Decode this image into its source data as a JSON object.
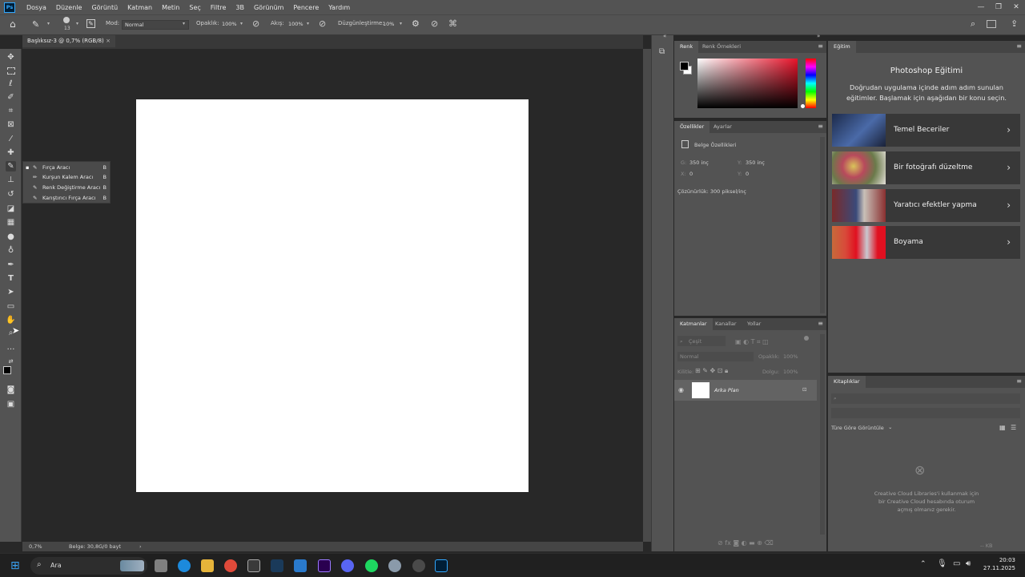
{
  "menu": [
    "Dosya",
    "Düzenle",
    "Görüntü",
    "Katman",
    "Metin",
    "Seç",
    "Filtre",
    "3B",
    "Görünüm",
    "Pencere",
    "Yardım"
  ],
  "app_logo": "Ps",
  "options": {
    "brush_size": "13",
    "mode_label": "Mod:",
    "mode_value": "Normal",
    "opacity_label": "Opaklık:",
    "opacity_value": "100%",
    "flow_label": "Akış:",
    "flow_value": "100%",
    "smoothing_label": "Düzgünleştirme:",
    "smoothing_value": "10%"
  },
  "document": {
    "tab_title": "Başlıksız-3 @ 0,7% (RGB/8)",
    "zoom": "0,7%",
    "doc_info": "Belge: 30,8G/0 bayt"
  },
  "flyout": [
    {
      "label": "Fırça Aracı",
      "key": "B"
    },
    {
      "label": "Kurşun Kalem Aracı",
      "key": "B"
    },
    {
      "label": "Renk Değiştirme Aracı",
      "key": "B"
    },
    {
      "label": "Karıştırıcı Fırça Aracı",
      "key": "B"
    }
  ],
  "color_panel": {
    "tab_active": "Renk",
    "tab_other": "Renk Örnekleri",
    "hue_color": "#e8132a"
  },
  "properties_panel": {
    "tab_active": "Özellikler",
    "tab_other": "Ayarlar",
    "section": "Belge Özellikleri",
    "w_label": "G:",
    "w_value": "350 inç",
    "h_label": "Y:",
    "h_value": "350 inç",
    "x_label": "X:",
    "x_value": "0",
    "y_label": "Y:",
    "y_value": "0",
    "resolution": "Çözünürlük: 300 piksel/inç"
  },
  "layers_panel": {
    "tabs": [
      "Katmanlar",
      "Kanallar",
      "Yollar"
    ],
    "search": "Çeşit",
    "blend": "Normal",
    "opacity_label": "Opaklık:",
    "opacity_value": "100%",
    "lock_label": "Kilitle:",
    "fill_label": "Dolgu:",
    "fill_value": "100%",
    "layer_name": "Arka Plan"
  },
  "learn_panel": {
    "tab": "Eğitim",
    "title": "Photoshop Eğitimi",
    "subtitle_1": "Doğrudan uygulama içinde adım adım sunulan",
    "subtitle_2": "eğitimler. Başlamak için aşağıdan bir konu seçin.",
    "cards": [
      "Temel Beceriler",
      "Bir fotoğrafı düzeltme",
      "Yaratıcı efektler yapma",
      "Boyama"
    ]
  },
  "libraries_panel": {
    "tab": "Kitaplıklar",
    "view_label": "Türe Göre Görüntüle",
    "msg_1": "Creative Cloud Libraries'i kullanmak için",
    "msg_2": "bir Creative Cloud hesabında oturum",
    "msg_3": "açmış olmanız gerekir.",
    "kb": "-- KB"
  },
  "taskbar": {
    "search": "Ara",
    "time": "20:03",
    "date": "27.11.2025"
  }
}
